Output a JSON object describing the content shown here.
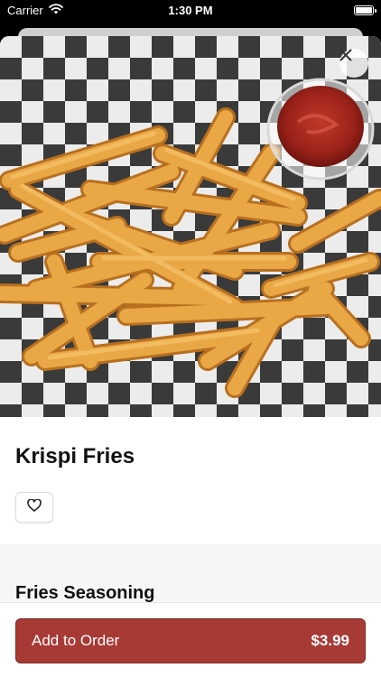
{
  "status_bar": {
    "carrier": "Carrier",
    "time": "1:30 PM"
  },
  "item": {
    "name": "Krispi Fries",
    "image_subject": "basket of french fries with ketchup cup on checkered paper"
  },
  "sections": {
    "seasoning_title": "Fries Seasoning"
  },
  "footer": {
    "add_label": "Add to Order",
    "price": "$3.99"
  },
  "colors": {
    "primary_button": "#a83a36",
    "fries": "#e6a23c",
    "ketchup": "#a8251a"
  },
  "icons": [
    "wifi-icon",
    "battery-icon",
    "close-icon",
    "heart-icon"
  ]
}
